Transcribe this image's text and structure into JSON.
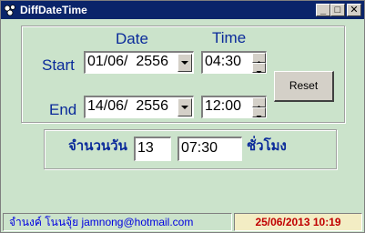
{
  "window": {
    "title": "DiffDateTime",
    "minimize": "_",
    "maximize": "□",
    "close": "✕"
  },
  "headers": {
    "date": "Date",
    "time": "Time"
  },
  "start": {
    "label": "Start",
    "date": "01/06/  2556",
    "time": "04:30"
  },
  "end": {
    "label": "End",
    "date": "14/06/  2556",
    "time": "12:00"
  },
  "reset_label": "Reset",
  "result": {
    "days_label": "จำนวนวัน",
    "days_value": "13",
    "time_value": "07:30",
    "hours_label": "ชั่วโมง"
  },
  "status": {
    "author": "จำนงค์ โนนจุ้ย jamnong@hotmail.com",
    "datetime": "25/06/2013 10:19"
  },
  "colors": {
    "background": "#cbe3cb",
    "label_blue": "#0a2a9a",
    "status_author": "#0000e0",
    "status_datetime": "#c00000",
    "status_datetime_bg": "#f3edc4"
  }
}
